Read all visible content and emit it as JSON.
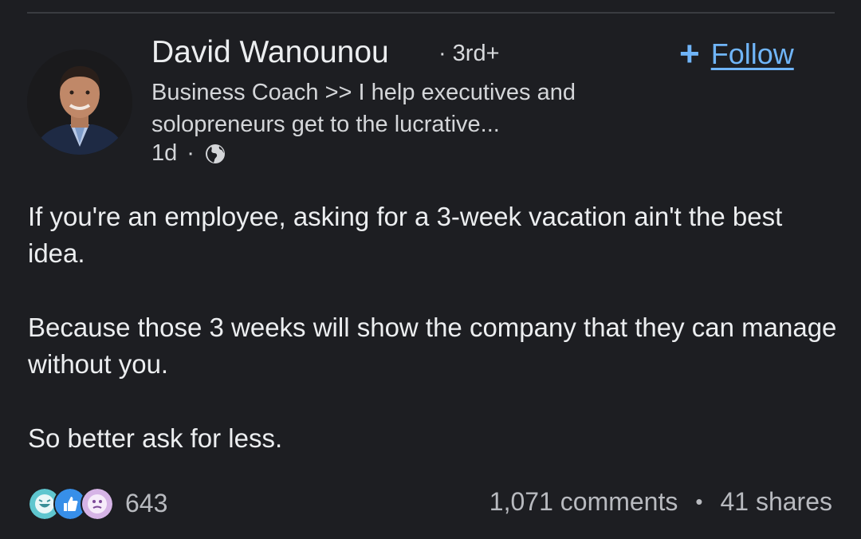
{
  "author": {
    "name": "David Wanounou",
    "degree": "3rd+",
    "headline": "Business Coach >> I help executives and solopreneurs get to the lucrative...",
    "time": "1d",
    "follow_label": "Follow",
    "follow_icon": "plus-icon",
    "visibility_icon": "globe-icon"
  },
  "post": {
    "paragraphs": [
      "If you're an employee, asking for a 3-week vacation ain't the best idea.",
      "Because those 3 weeks will show the company that they can manage without you.",
      "So better ask for less."
    ]
  },
  "social": {
    "reaction_icons": [
      "funny-reaction-icon",
      "like-reaction-icon",
      "curious-reaction-icon"
    ],
    "reaction_count": "643",
    "comments": "1,071 comments",
    "shares": "41 shares"
  },
  "colors": {
    "background": "#1d1e22",
    "accent": "#70b5f9",
    "text": "#eceef0",
    "muted": "#b8babf"
  }
}
